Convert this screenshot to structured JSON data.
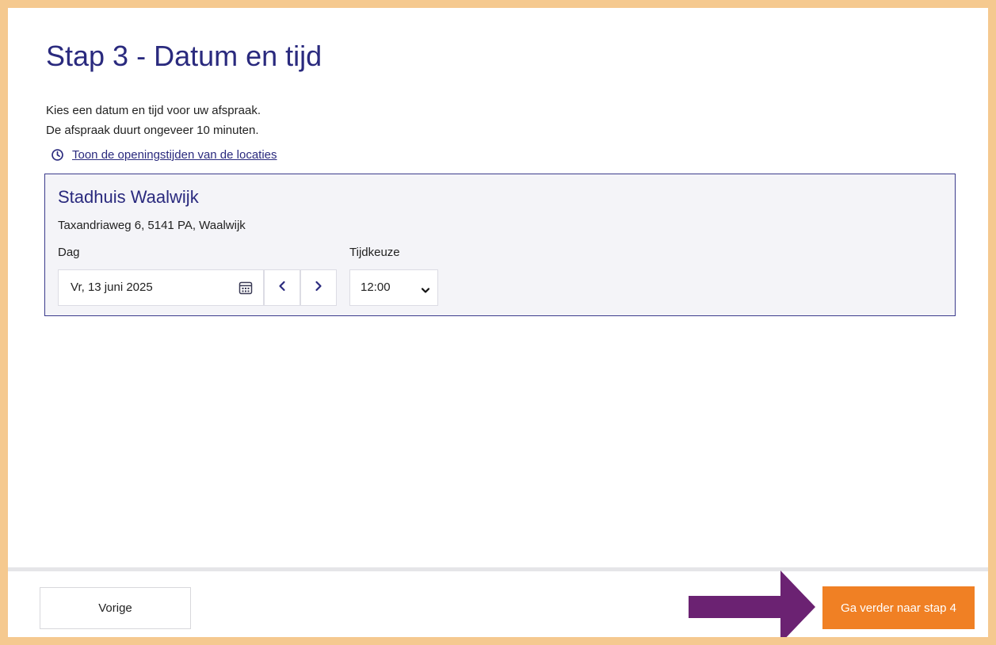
{
  "page": {
    "title": "Stap 3 - Datum en tijd",
    "intro_line1": "Kies een datum en tijd voor uw afspraak.",
    "intro_line2": "De afspraak duurt ongeveer 10 minuten."
  },
  "hours_link": {
    "icon": "clock-icon",
    "label": "Toon de openingstijden van de locaties"
  },
  "location": {
    "name": "Stadhuis Waalwijk",
    "address": "Taxandriaweg 6, 5141 PA, Waalwijk",
    "day_label": "Dag",
    "day_value": "Vr, 13 juni 2025",
    "calendar_icon": "calendar-icon",
    "prev_icon": "chevron-left-icon",
    "next_icon": "chevron-right-icon",
    "time_label": "Tijdkeuze",
    "time_value": "12:00",
    "time_icon": "chevron-down-icon"
  },
  "footer": {
    "prev_label": "Vorige",
    "next_label": "Ga verder naar stap 4",
    "arrow_icon": "arrow-right-icon"
  },
  "colors": {
    "frame_border": "#f5c98f",
    "title": "#2a2a7e",
    "card_background": "#f4f4f8",
    "card_border": "#3b3b8c",
    "primary_button": "#f08024",
    "arrow": "#6b2272"
  }
}
